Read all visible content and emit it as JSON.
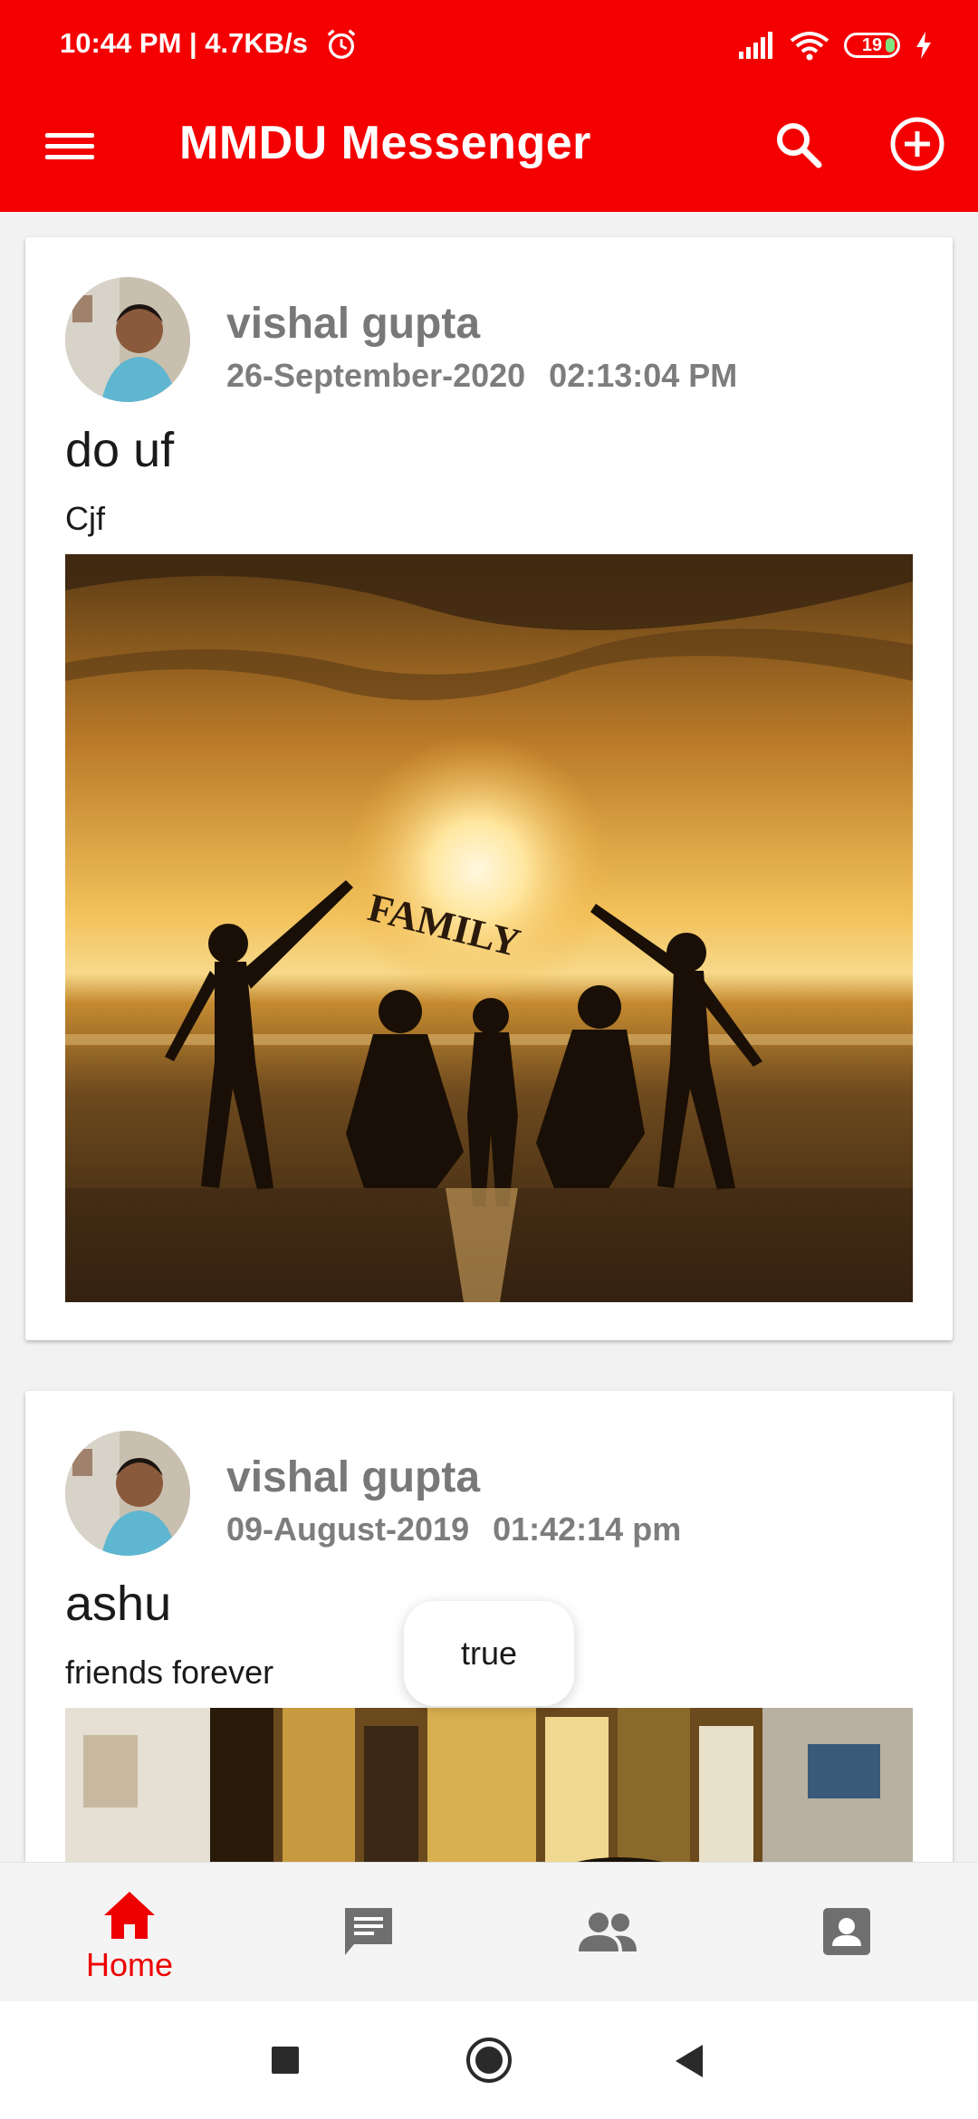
{
  "status_bar": {
    "time_speed": "10:44 PM | 4.7KB/s",
    "battery": "19"
  },
  "app_bar": {
    "title": "MMDU Messenger"
  },
  "posts": [
    {
      "author": "vishal gupta",
      "date": "26-September-2020",
      "time": "02:13:04 PM",
      "title": "do uf",
      "description": "Cjf",
      "image_text": "FAMILY"
    },
    {
      "author": "vishal gupta",
      "date": "09-August-2019",
      "time": "01:42:14 pm",
      "title": "ashu",
      "description": "friends forever"
    }
  ],
  "toast": {
    "text": "true"
  },
  "bottom_nav": {
    "items": [
      {
        "label": "Home",
        "icon": "home-icon",
        "active": true
      },
      {
        "label": "",
        "icon": "chat-icon",
        "active": false
      },
      {
        "label": "",
        "icon": "people-icon",
        "active": false
      },
      {
        "label": "",
        "icon": "profile-icon",
        "active": false
      }
    ]
  },
  "colors": {
    "primary": "#f40000",
    "active_nav": "#ee0000",
    "inactive_nav": "#6f6f6f"
  }
}
